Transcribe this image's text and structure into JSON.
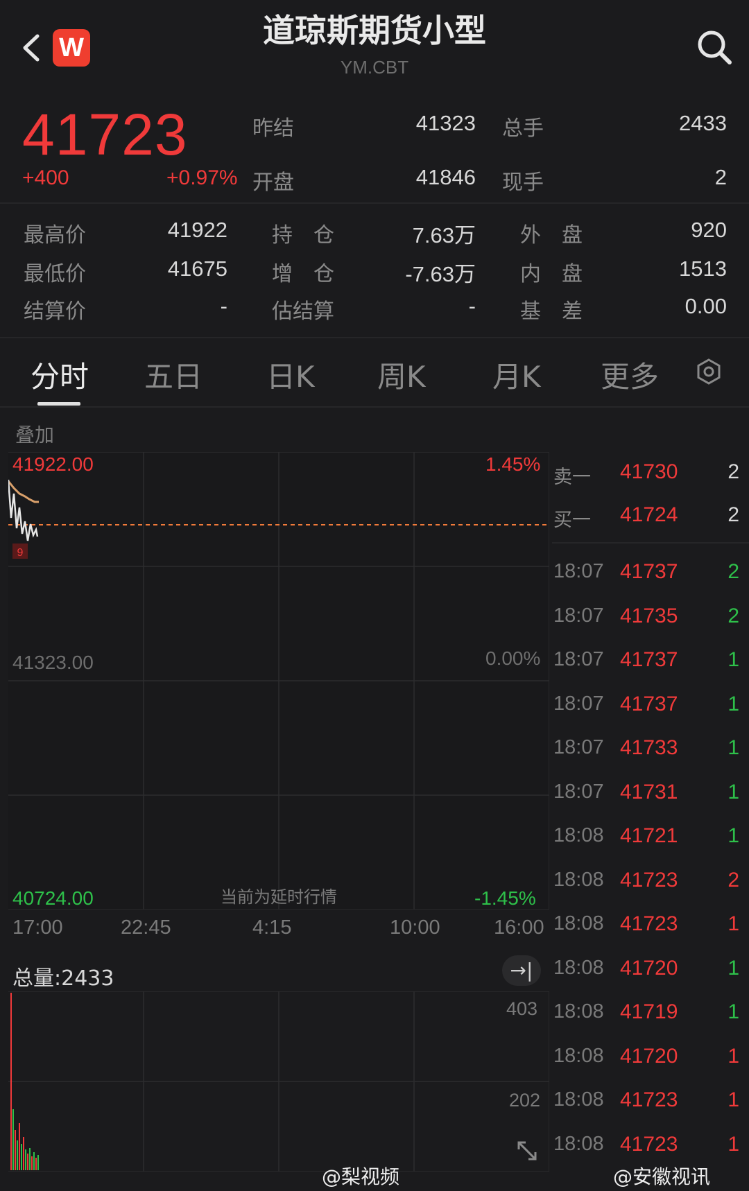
{
  "header": {
    "title": "道琼斯期货小型",
    "subtitle": "YM.CBT",
    "logo_letter": "W",
    "back_icon": "chevron-left-icon",
    "search_icon": "search-icon"
  },
  "quote": {
    "price": "41723",
    "change": "+400",
    "change_pct": "+0.97%",
    "prev_settle_label": "昨结",
    "prev_settle": "41323",
    "open_label": "开盘",
    "open": "41846",
    "total_volume_label": "总手",
    "total_volume": "2433",
    "last_volume_label": "现手",
    "last_volume": "2"
  },
  "stats": {
    "high_label": "最高价",
    "high": "41922",
    "low_label": "最低价",
    "low": "41675",
    "settle_label": "结算价",
    "settle": "-",
    "oi_label": "持　仓",
    "oi": "7.63万",
    "oi_change_label": "增　仓",
    "oi_change": "-7.63万",
    "est_settle_label": "估结算",
    "est_settle": "-",
    "outer_label": "外　盘",
    "outer": "920",
    "inner_label": "内　盘",
    "inner": "1513",
    "basis_label": "基　差",
    "basis": "0.00"
  },
  "tabs": [
    "分时",
    "五日",
    "日K",
    "周K",
    "月K",
    "更多"
  ],
  "chart": {
    "overlay_label": "叠加",
    "top_price": "41922.00",
    "top_pct": "1.45%",
    "mid_price": "41323.00",
    "mid_pct": "0.00%",
    "bottom_price": "40724.00",
    "bottom_pct": "-1.45%",
    "delay_note": "当前为延时行情",
    "marker": "9",
    "times": [
      "17:00",
      "22:45",
      "4:15",
      "10:00",
      "16:00"
    ],
    "colors": {
      "up": "#f03a3a",
      "down": "#2ec04a",
      "avg_line": "#d9a06b",
      "price_line": "#e6e6e6",
      "ref_line": "#f07a3a"
    }
  },
  "volume": {
    "label": "总量:2433",
    "scale_top": "403",
    "scale_mid": "202",
    "expand_icon": "arrow-to-right-icon",
    "fullscreen_icon": "fullscreen-icon"
  },
  "orderbook": {
    "ask_label": "卖一",
    "ask_price": "41730",
    "ask_qty": "2",
    "bid_label": "买一",
    "bid_price": "41724",
    "bid_qty": "2"
  },
  "trades": [
    {
      "time": "18:07",
      "price": "41737",
      "qty": "2",
      "dir": "green"
    },
    {
      "time": "18:07",
      "price": "41735",
      "qty": "2",
      "dir": "green"
    },
    {
      "time": "18:07",
      "price": "41737",
      "qty": "1",
      "dir": "green"
    },
    {
      "time": "18:07",
      "price": "41737",
      "qty": "1",
      "dir": "green"
    },
    {
      "time": "18:07",
      "price": "41733",
      "qty": "1",
      "dir": "green"
    },
    {
      "time": "18:07",
      "price": "41731",
      "qty": "1",
      "dir": "green"
    },
    {
      "time": "18:08",
      "price": "41721",
      "qty": "1",
      "dir": "green"
    },
    {
      "time": "18:08",
      "price": "41723",
      "qty": "2",
      "dir": "red"
    },
    {
      "time": "18:08",
      "price": "41723",
      "qty": "1",
      "dir": "red"
    },
    {
      "time": "18:08",
      "price": "41720",
      "qty": "1",
      "dir": "green"
    },
    {
      "time": "18:08",
      "price": "41719",
      "qty": "1",
      "dir": "green"
    },
    {
      "time": "18:08",
      "price": "41720",
      "qty": "1",
      "dir": "red"
    },
    {
      "time": "18:08",
      "price": "41723",
      "qty": "1",
      "dir": "red"
    },
    {
      "time": "18:08",
      "price": "41723",
      "qty": "1",
      "dir": "red"
    }
  ],
  "watermarks": [
    "@梨视频",
    "@安徽视讯"
  ]
}
